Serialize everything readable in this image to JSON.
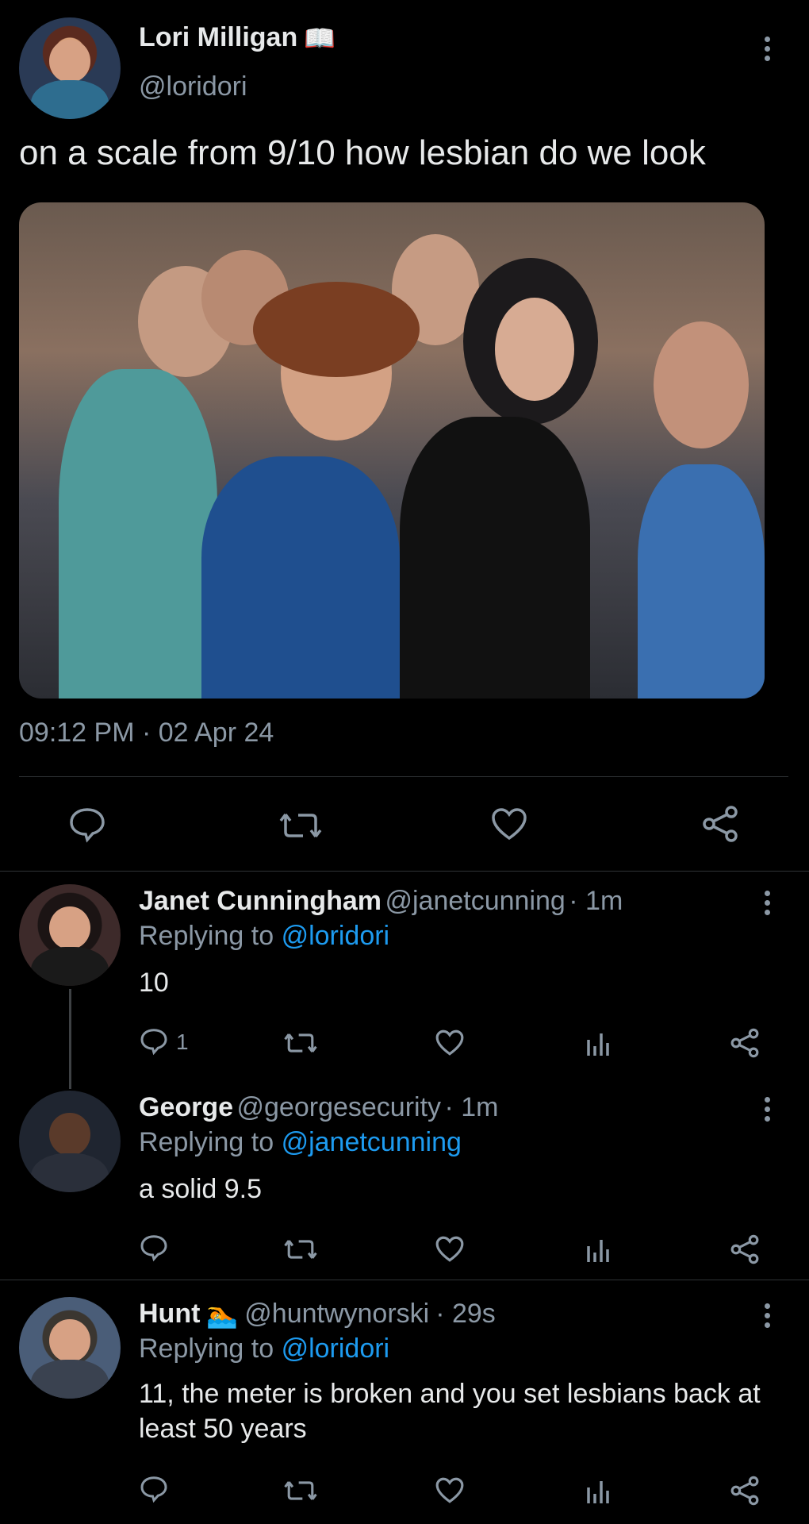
{
  "tweet": {
    "author_name": "Lori Milligan",
    "author_emoji": "📖",
    "author_handle": "@loridori",
    "text": "on a scale from 9/10 how lesbian do we look",
    "timestamp": "09:12 PM · 02 Apr 24"
  },
  "replies": [
    {
      "name": "Janet Cunningham",
      "handle": "@janetcunning",
      "time": "· 1m",
      "replying_label": "Replying to",
      "replying_to": "@loridori",
      "text": "10",
      "reply_count": "1"
    },
    {
      "name": "George",
      "handle": "@georgesecurity",
      "time": "· 1m",
      "replying_label": "Replying to",
      "replying_to": "@janetcunning",
      "text": "a solid 9.5",
      "reply_count": ""
    },
    {
      "name": "Hunt",
      "name_emoji": "🏊",
      "handle": "@huntwynorski",
      "time": "· 29s",
      "replying_label": "Replying to",
      "replying_to": "@loridori",
      "text": "11, the meter is broken and you set lesbians back at least 50 years",
      "reply_count": ""
    }
  ],
  "colors": {
    "background": "#000000",
    "text": "#e7e9ea",
    "muted": "#8b98a5",
    "link": "#1d9bf0",
    "divider": "#2f3336"
  },
  "icons": [
    "comment-icon",
    "retweet-icon",
    "like-icon",
    "share-icon",
    "views-icon",
    "more-icon",
    "book-emoji",
    "swimmer-emoji"
  ]
}
